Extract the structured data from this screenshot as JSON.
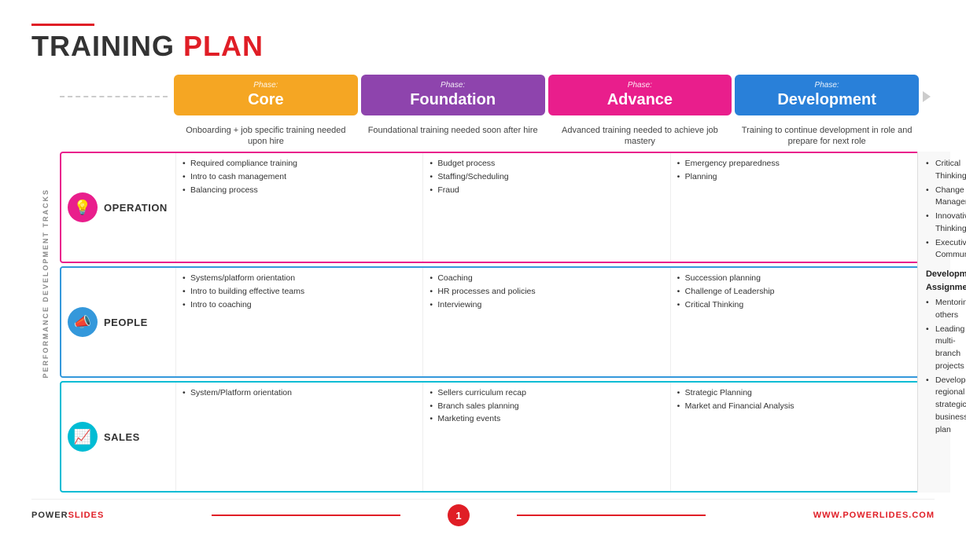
{
  "header": {
    "red_line": true,
    "title_part1": "TRAINING ",
    "title_part2": "PLAN"
  },
  "left_label": "PERFORMANCE DEVELOPMENT TRACKS",
  "phases": [
    {
      "id": "core",
      "label": "Phase:",
      "name": "Core",
      "color_class": "core",
      "description": "Onboarding + job specific training needed upon hire"
    },
    {
      "id": "foundation",
      "label": "Phase:",
      "name": "Foundation",
      "color_class": "foundation",
      "description": "Foundational training needed soon after hire"
    },
    {
      "id": "advance",
      "label": "Phase:",
      "name": "Advance",
      "color_class": "advance",
      "description": "Advanced training needed to achieve job mastery"
    },
    {
      "id": "development",
      "label": "Phase:",
      "name": "Development",
      "color_class": "development",
      "description": "Training to continue development in role and prepare for next role"
    }
  ],
  "tracks": [
    {
      "id": "operation",
      "name": "OPERATION",
      "icon": "💡",
      "icon_class": "op",
      "border_class": "operation",
      "core_items": [
        "Required compliance training",
        "Intro to cash management",
        "Balancing process"
      ],
      "foundation_items": [
        "Budget process",
        "Staffing/Scheduling",
        "Fraud"
      ],
      "advance_items": [
        "Emergency preparedness",
        "Planning"
      ]
    },
    {
      "id": "people",
      "name": "PEOPLE",
      "icon": "📣",
      "icon_class": "people",
      "border_class": "people",
      "core_items": [
        "Systems/platform orientation",
        "Intro to building effective teams",
        "Intro to coaching"
      ],
      "foundation_items": [
        "Coaching",
        "HR processes and policies",
        "Interviewing"
      ],
      "advance_items": [
        "Succession planning",
        "Challenge of Leadership",
        "Critical Thinking"
      ]
    },
    {
      "id": "sales",
      "name": "SALES",
      "icon": "📊",
      "icon_class": "sales",
      "border_class": "sales",
      "core_items": [
        "System/Platform orientation"
      ],
      "foundation_items": [
        "Sellers curriculum recap",
        "Branch sales planning",
        "Marketing events"
      ],
      "advance_items": [
        "Strategic Planning",
        "Market and Financial Analysis"
      ]
    }
  ],
  "development_col": {
    "phase_items": [
      "Critical Thinking",
      "Change Management",
      "Innovative Thinking",
      "Executive Communications"
    ],
    "assignments_title": "Developmental Assignments",
    "assignment_items": [
      "Mentoring others",
      "Leading multi-branch projects",
      "Develop regional strategic business plan"
    ]
  },
  "footer": {
    "brand_power": "POWER",
    "brand_slides": "SLIDES",
    "page_number": "1",
    "url": "WWW.POWERLIDES.COM"
  }
}
